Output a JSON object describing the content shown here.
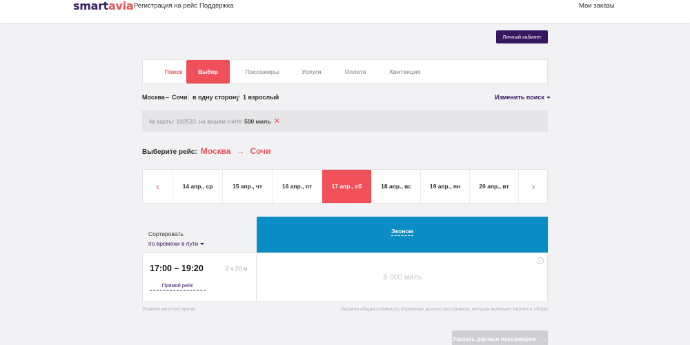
{
  "header": {
    "logo": {
      "part1": "smart",
      "part2": "avia"
    },
    "nav": [
      "Регистрация на рейс",
      "Поддержка"
    ],
    "my_orders": "Мои заказы"
  },
  "cabinet_button": "Личный кабинет",
  "steps": [
    {
      "label": "Поиск",
      "state": "done"
    },
    {
      "label": "Выбор",
      "state": "active"
    },
    {
      "label": "Пассажиры",
      "state": "pending"
    },
    {
      "label": "Услуги",
      "state": "pending"
    },
    {
      "label": "Оплата",
      "state": "pending"
    },
    {
      "label": "Квитанция",
      "state": "pending"
    }
  ],
  "search_summary": {
    "from": "Москва",
    "dash": "–",
    "to": "Сочи",
    "trip_type": "в одну сторону",
    "passengers": "1 взрослый",
    "change_search": "Изменить поиск"
  },
  "card_info": {
    "text": "№ карты: 102533, на вашем счёте",
    "miles": "500 миль",
    "close": "✕"
  },
  "choose_flight": {
    "label": "Выберите рейс:",
    "from": "Москва",
    "arrow": "→",
    "to": "Сочи"
  },
  "dates": {
    "prev": "‹",
    "next": "›",
    "items": [
      "14 апр., ср",
      "15 апр., чт",
      "16 апр., пт",
      "17 апр., сб",
      "18 апр., вс",
      "19 апр., пн",
      "20 апр., вт"
    ],
    "selected": "17 апр., сб"
  },
  "sort": {
    "title": "Сортировать",
    "value": "по времени в пути"
  },
  "fare_class": "Эконом",
  "flight": {
    "time": "17:00 – 19:20",
    "duration": "2 ч 20 м",
    "type": "Прямой рейс",
    "price": "8 000 миль",
    "info_icon": "i"
  },
  "notes": {
    "left": "Указано местное время",
    "right": "Указана общая стоимость перевозки за всех пассажиров, которая включает налоги и сборы"
  },
  "next_button": {
    "label": "Указать данные пассажиров",
    "arrow": "→"
  },
  "colors": {
    "brand_purple": "#35165f",
    "accent_red": "#f0505a",
    "fare_blue": "#0a8dc4"
  }
}
